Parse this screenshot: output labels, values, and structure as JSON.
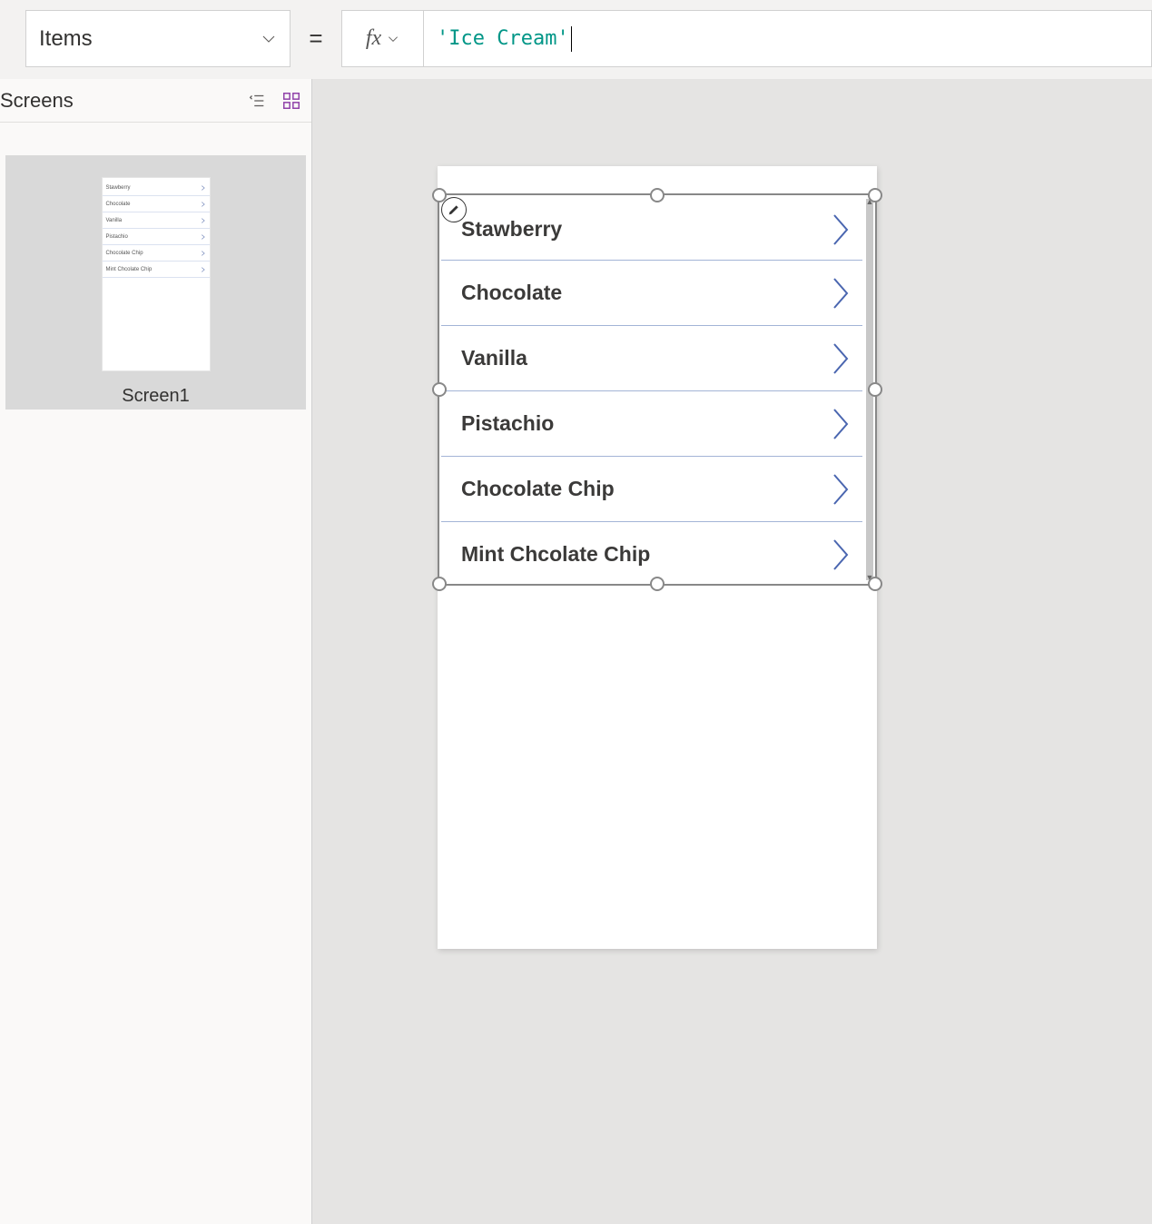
{
  "propertySelect": {
    "label": "Items"
  },
  "equals": "=",
  "fx": "fx",
  "formula": "'Ice Cream'",
  "leftPanel": {
    "title": "Screens",
    "screenLabel": "Screen1"
  },
  "gallery": {
    "items": [
      {
        "label": "Stawberry"
      },
      {
        "label": "Chocolate"
      },
      {
        "label": "Vanilla"
      },
      {
        "label": "Pistachio"
      },
      {
        "label": "Chocolate Chip"
      },
      {
        "label": "Mint Chcolate Chip"
      }
    ]
  },
  "colors": {
    "chevron": "#4a66b0",
    "formulaText": "#009687"
  }
}
